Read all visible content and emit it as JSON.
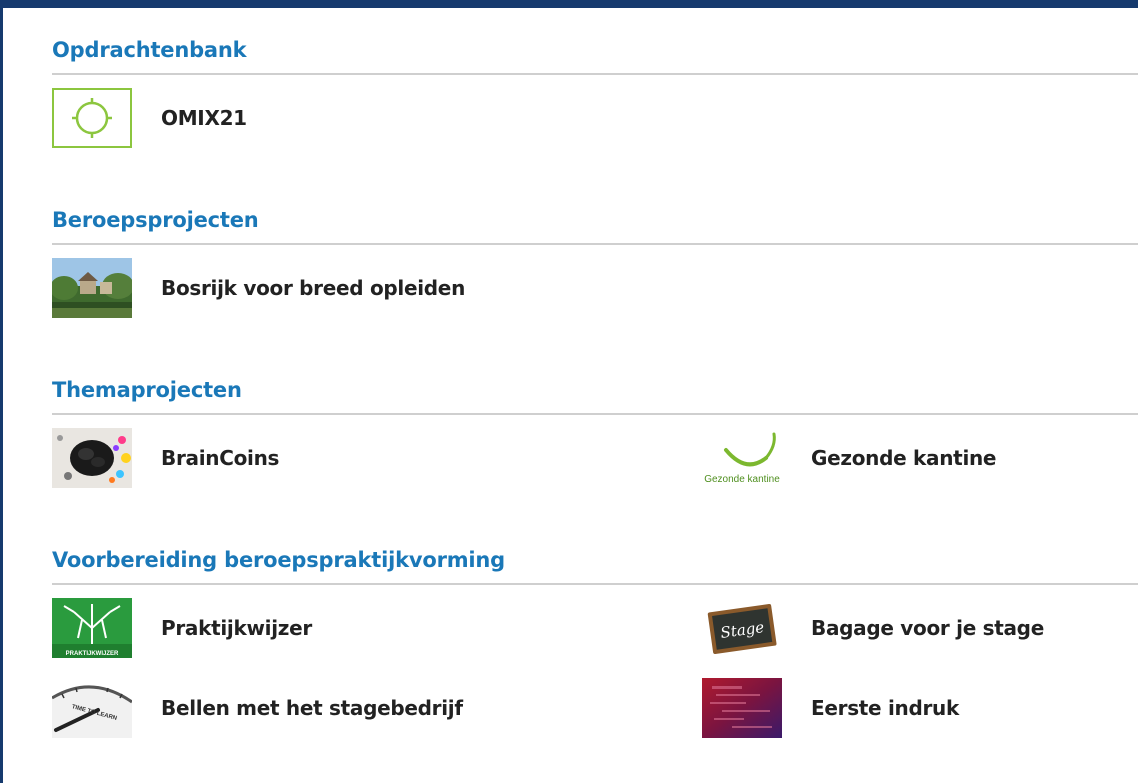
{
  "sections": [
    {
      "title": "Opdrachtenbank",
      "items": [
        {
          "label": "OMIX21",
          "icon": "omix-target-icon"
        }
      ]
    },
    {
      "title": "Beroepsprojecten",
      "items": [
        {
          "label": "Bosrijk voor breed opleiden",
          "icon": "forest-house-thumbnail"
        }
      ]
    },
    {
      "title": "Themaprojecten",
      "items": [
        {
          "label": "BrainCoins",
          "icon": "colorful-brain-thumbnail"
        },
        {
          "label": "Gezonde kantine",
          "icon": "gezonde-kantine-logo",
          "logo_text": "Gezonde kantine"
        }
      ]
    },
    {
      "title": "Voorbereiding beroepspraktijkvorming",
      "items": [
        {
          "label": "Praktijkwijzer",
          "icon": "praktijkwijzer-tree-thumbnail",
          "logo_text": "PRAKTIJKWIJZER"
        },
        {
          "label": "Bagage voor je stage",
          "icon": "stage-chalkboard-thumbnail",
          "logo_text": "Stage"
        },
        {
          "label": "Bellen met het stagebedrijf",
          "icon": "time-to-learn-clock-thumbnail",
          "logo_text": "TIME TO LEARN"
        },
        {
          "label": "Eerste indruk",
          "icon": "eerste-indruk-thumbnail"
        }
      ]
    }
  ],
  "colors": {
    "frame": "#163a6e",
    "section_title": "#1a78b8",
    "rule": "#cfcfcf",
    "label": "#222222",
    "omix_green": "#8cc63f"
  }
}
